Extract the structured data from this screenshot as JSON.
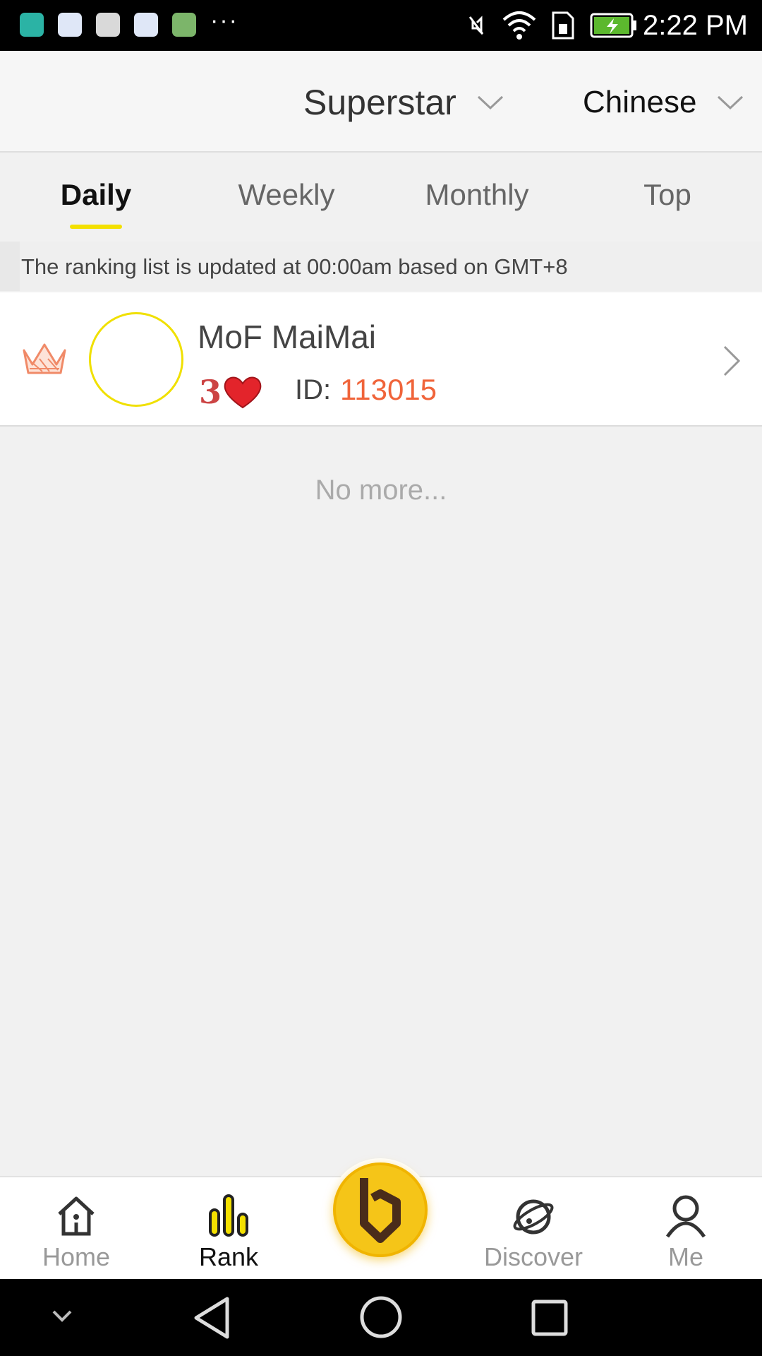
{
  "status_bar": {
    "time": "2:22 PM",
    "icons": [
      "android-app-icon",
      "baidu-icon",
      "font-app-icon",
      "baidu-icon",
      "telegram-icon",
      "overflow-dots",
      "muted-icon",
      "wifi-icon",
      "sim-icon",
      "battery-charging-icon"
    ],
    "overflow": "···"
  },
  "header": {
    "category": "Superstar",
    "language": "Chinese"
  },
  "tabs": [
    {
      "label": "Daily",
      "active": true
    },
    {
      "label": "Weekly",
      "active": false
    },
    {
      "label": "Monthly",
      "active": false
    },
    {
      "label": "Top",
      "active": false
    }
  ],
  "notice": "The ranking list is updated at 00:00am based on GMT+8",
  "ranking": [
    {
      "name": "MoF MaiMai",
      "level": "3",
      "id_label": "ID:",
      "id_value": "113015"
    }
  ],
  "footer_text": "No more...",
  "bottom_nav": [
    {
      "label": "Home",
      "icon": "home-icon",
      "active": false
    },
    {
      "label": "Rank",
      "icon": "rank-bars-icon",
      "active": true
    },
    {
      "label": "Discover",
      "icon": "planet-icon",
      "active": false
    },
    {
      "label": "Me",
      "icon": "person-icon",
      "active": false
    }
  ],
  "colors": {
    "accent": "#f3e000",
    "id_value": "#f0643a",
    "center_button": "#f5c518"
  }
}
